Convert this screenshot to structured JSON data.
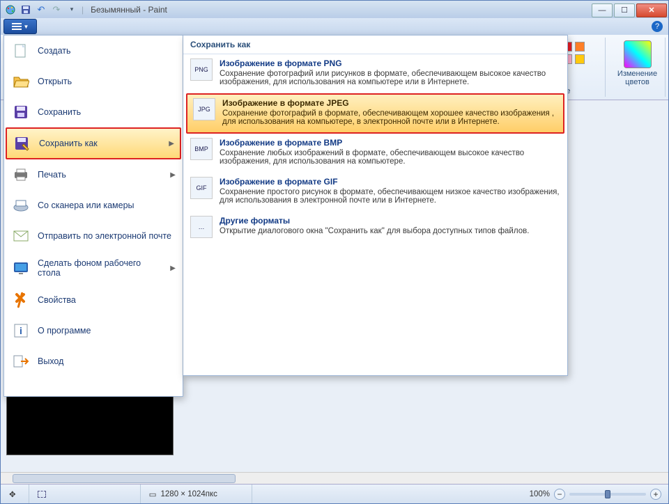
{
  "title": "Безымянный - Paint",
  "qat": {
    "save": "save",
    "undo": "undo",
    "redo": "redo"
  },
  "fileMenu": {
    "items": [
      {
        "label": "Создать",
        "icon": "new-file-icon",
        "sub": false
      },
      {
        "label": "Открыть",
        "icon": "open-folder-icon",
        "sub": false
      },
      {
        "label": "Сохранить",
        "icon": "save-icon",
        "sub": false
      },
      {
        "label": "Сохранить как",
        "icon": "save-as-icon",
        "sub": true,
        "selected": true
      },
      {
        "label": "Печать",
        "icon": "print-icon",
        "sub": true
      },
      {
        "label": "Со сканера или камеры",
        "icon": "scanner-icon",
        "sub": false
      },
      {
        "label": "Отправить по электронной почте",
        "icon": "mail-icon",
        "sub": false
      },
      {
        "label": "Сделать фоном рабочего стола",
        "icon": "wallpaper-icon",
        "sub": true
      },
      {
        "label": "Свойства",
        "icon": "properties-icon",
        "sub": false
      },
      {
        "label": "О программе",
        "icon": "about-icon",
        "sub": false
      },
      {
        "label": "Выход",
        "icon": "exit-icon",
        "sub": false
      }
    ]
  },
  "flyout": {
    "title": "Сохранить как",
    "items": [
      {
        "name": "png",
        "title": "Изображение в формате PNG",
        "desc": "Сохранение фотографий или рисунков в формате, обеспечивающем высокое качество изображения, для использования на компьютере или в Интернете."
      },
      {
        "name": "jpeg",
        "title": "Изображение в формате JPEG",
        "selected": true,
        "desc": "Сохранение фотографий в формате, обеспечивающем хорошее качество изображения , для использования на компьютере, в электронной почте или в Интернете."
      },
      {
        "name": "bmp",
        "title": "Изображение в формате BMP",
        "desc": "Сохранение любых изображений в формате, обеспечивающем высокое качество изображения, для использования на компьютере."
      },
      {
        "name": "gif",
        "title": "Изображение в формате GIF",
        "desc": "Сохранение простого рисунок в формате, обеспечивающем низкое качество изображения, для использования в электронной почте или в Интернете."
      },
      {
        "name": "other",
        "title": "Другие форматы",
        "desc": "Открытие диалогового окна \"Сохранить как\" для выбора доступных типов файлов."
      }
    ]
  },
  "ribbon": {
    "changeColors": "Изменение цветов",
    "colorsCaption": "Цве",
    "editColors": "ет",
    "swatches_row1": [
      "#000000",
      "#7f7f7f",
      "#880015",
      "#ed1c24",
      "#ff7f27"
    ],
    "swatches_row2": [
      "#ffffff",
      "#c3c3c3",
      "#b97a57",
      "#ffaec9",
      "#ffc90e"
    ]
  },
  "status": {
    "coords": "",
    "size": "1280 × 1024пкс",
    "zoom": "100%"
  }
}
